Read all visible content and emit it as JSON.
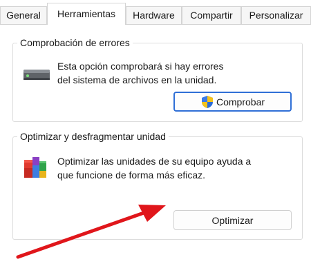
{
  "tabs": [
    {
      "label": "General"
    },
    {
      "label": "Herramientas"
    },
    {
      "label": "Hardware"
    },
    {
      "label": "Compartir"
    },
    {
      "label": "Personalizar"
    }
  ],
  "error_check": {
    "title": "Comprobación de errores",
    "line1": "Esta opción comprobará si hay errores",
    "line2": "del sistema de archivos en la unidad.",
    "button_label": "Comprobar",
    "icon": "hard-drive-icon",
    "button_icon": "uac-shield-icon"
  },
  "optimize": {
    "title": "Optimizar y desfragmentar unidad",
    "line1": "Optimizar las unidades de su equipo ayuda a",
    "line2": "que funcione de forma más eficaz.",
    "button_label": "Optimizar",
    "icon": "defrag-icon"
  },
  "annotation": {
    "arrow_color": "#e0161b"
  }
}
